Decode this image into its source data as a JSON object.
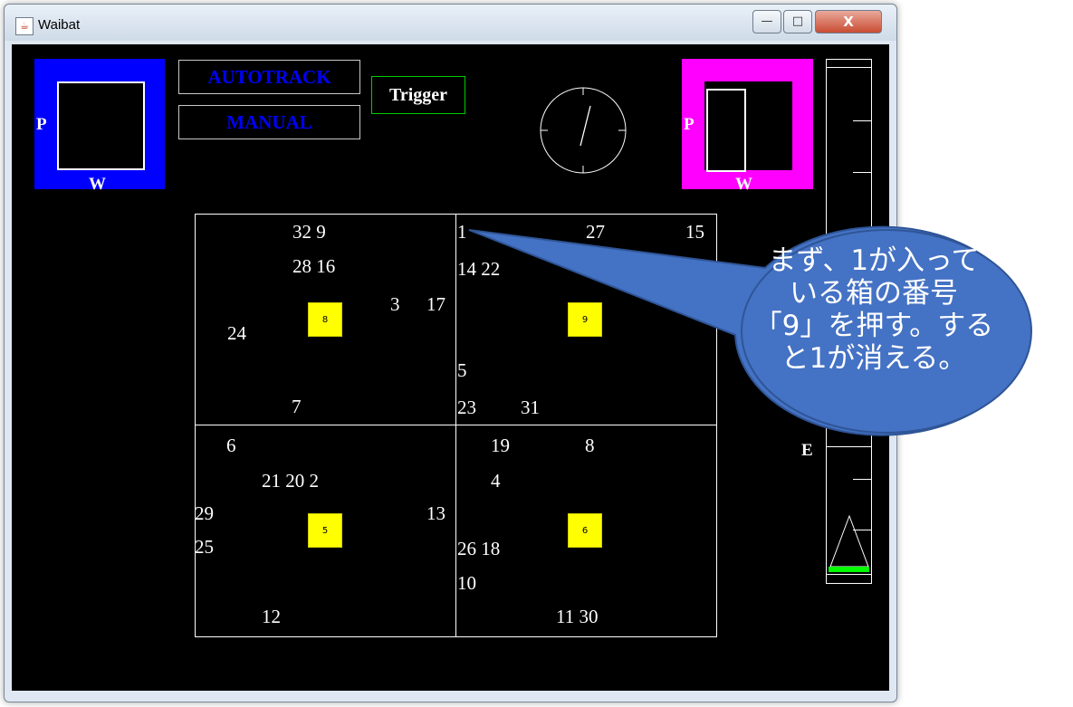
{
  "window": {
    "title": "Waibat",
    "app_icon": "java-icon",
    "controls": {
      "minimize": "—",
      "maximize": "□",
      "close": "X"
    }
  },
  "indicators": {
    "left": {
      "color": "#0000ff",
      "p_label": "P",
      "w_label": "W"
    },
    "right": {
      "color": "#ff00ff",
      "p_label": "P",
      "w_label": "W"
    }
  },
  "modes": {
    "autotrack": "AUTOTRACK",
    "manual": "MANUAL"
  },
  "trigger": "Trigger",
  "gauge": {
    "label": "E",
    "fill_color": "#00ff00"
  },
  "quadrants": [
    {
      "box_number": "8",
      "numbers": [
        "32 9",
        "28 16",
        "3",
        "17",
        "24",
        "7"
      ]
    },
    {
      "box_number": "9",
      "numbers": [
        "1",
        "27",
        "15",
        "14 22",
        "5",
        "23",
        "31"
      ]
    },
    {
      "box_number": "5",
      "numbers": [
        "6",
        "21 20 2",
        "29",
        "13",
        "25",
        "12"
      ]
    },
    {
      "box_number": "6",
      "numbers": [
        "19",
        "8",
        "4",
        "26 18",
        "10",
        "11 30"
      ]
    }
  ],
  "callout": {
    "lines": [
      "まず、1が入って",
      "いる箱の番号",
      "「9」を押す。する",
      "と1が消える。"
    ],
    "fill": "#4472c4"
  }
}
